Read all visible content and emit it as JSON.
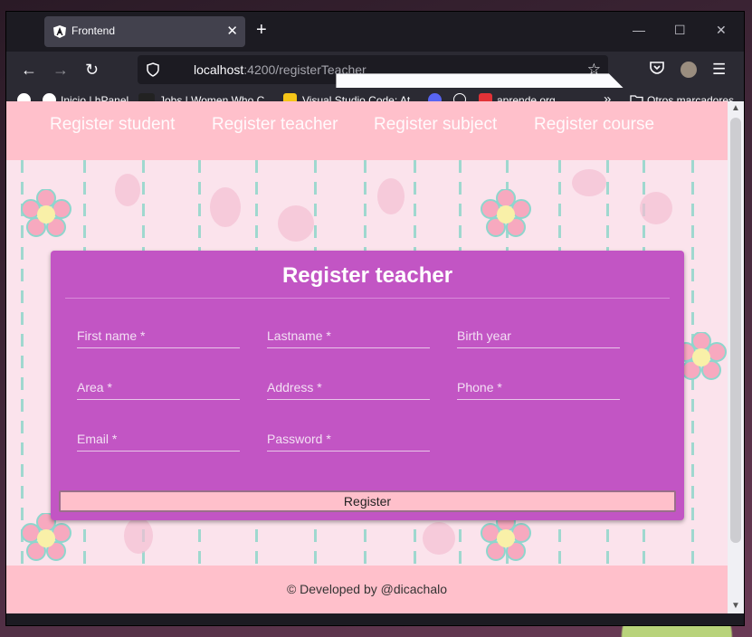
{
  "browser": {
    "tab_title": "Frontend",
    "tab_close": "✕",
    "new_tab": "+",
    "window_controls": {
      "minimize": "—",
      "maximize": "☐",
      "close": "✕"
    },
    "nav": {
      "back": "←",
      "forward": "→",
      "reload": "↻"
    },
    "url_host": "localhost",
    "url_path": ":4200/registerTeacher",
    "bookmark_star": "☆",
    "menu": "☰",
    "bookmarks": [
      {
        "label": "Inicio | hPanel"
      },
      {
        "label": "Jobs | Women Who C..."
      },
      {
        "label": "Visual Studio Code: At..."
      },
      {
        "label": "aprende.org"
      }
    ],
    "more_bookmarks": "»",
    "other_bookmarks": "Otros marcadores",
    "colors": {
      "chrome_dark": "#1c1b22",
      "toolbar": "#2b2a33"
    }
  },
  "app": {
    "nav_links": [
      "Register student",
      "Register teacher",
      "Register subject",
      "Register course"
    ],
    "form": {
      "title": "Register teacher",
      "fields": {
        "first_name": "First name *",
        "lastname": "Lastname *",
        "birth_year": "Birth year",
        "area": "Area *",
        "address": "Address *",
        "phone": "Phone *",
        "email": "Email *",
        "password": "Password *"
      },
      "submit_label": "Register"
    },
    "footer": "© Developed by @dicachalo",
    "colors": {
      "nav_bg": "#ffc0cb",
      "card_bg": "#c255c4",
      "button_bg": "#ffc0cb"
    }
  }
}
